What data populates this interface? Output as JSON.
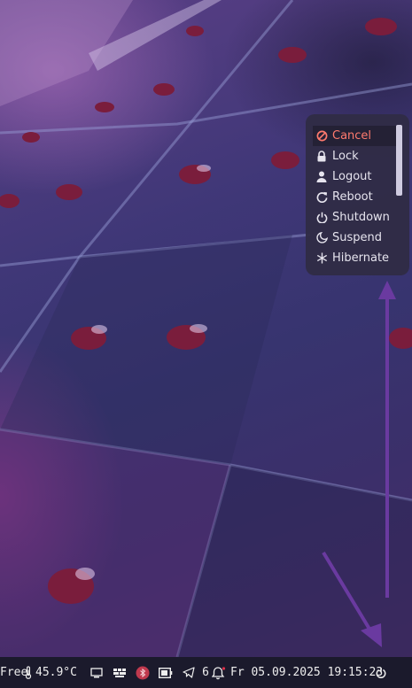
{
  "power_menu": {
    "items": [
      {
        "label": "Cancel",
        "icon": "cancel-icon"
      },
      {
        "label": "Lock",
        "icon": "lock-icon"
      },
      {
        "label": "Logout",
        "icon": "user-icon"
      },
      {
        "label": "Reboot",
        "icon": "reboot-icon"
      },
      {
        "label": "Shutdown",
        "icon": "power-icon"
      },
      {
        "label": "Suspend",
        "icon": "moon-icon"
      },
      {
        "label": "Hibernate",
        "icon": "snowflake-icon"
      }
    ],
    "active_index": 0
  },
  "panel": {
    "memory_label": "Free",
    "temperature": "45.9°C",
    "notification_count": "6",
    "datetime": "Fr 05.09.2025 19:15:23",
    "tray_icons": [
      "display-icon",
      "keyboard-layout-icon",
      "bluetooth-icon",
      "battery-icon",
      "telegram-icon",
      "bell-icon",
      "power-icon"
    ]
  },
  "colors": {
    "accent_cancel": "#ff7a6e",
    "menu_bg": "#302c46",
    "panel_bg": "#1b1a2c",
    "arrow": "#6a3aa0",
    "bluetooth_badge": "#c0394e"
  }
}
